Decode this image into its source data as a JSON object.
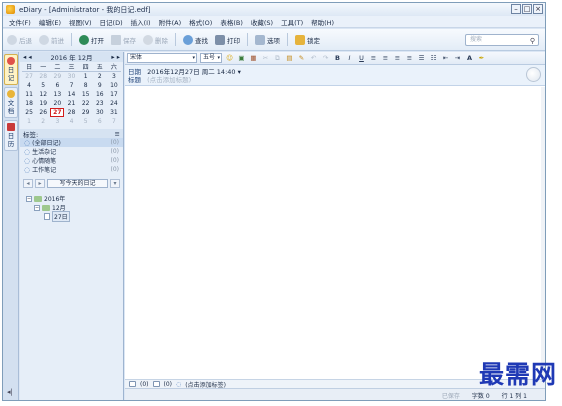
{
  "window": {
    "title": "eDiary - [Administrator - 我的日记.edf]",
    "controls": [
      "–",
      "□",
      "×"
    ]
  },
  "menu": [
    "文件(F)",
    "编辑(E)",
    "视图(V)",
    "日记(D)",
    "插入(I)",
    "附件(A)",
    "格式(O)",
    "表格(B)",
    "收藏(S)",
    "工具(T)",
    "帮助(H)"
  ],
  "toolbar": {
    "back": "后退",
    "forward": "前进",
    "open": "打开",
    "save": "保存",
    "delete": "删除",
    "find": "查找",
    "print": "打印",
    "options": "选项",
    "lock": "锁定",
    "search_placeholder": "搜索"
  },
  "leftstrip": {
    "tab_diary": "日记",
    "tab_docs": "文档",
    "tab_calendar": "日历"
  },
  "calendar": {
    "prev": "◂ ◂",
    "title": "2016 年 12月",
    "next": "▸ ▸",
    "weekdays": [
      "日",
      "一",
      "二",
      "三",
      "四",
      "五",
      "六"
    ],
    "weeks": [
      [
        "27",
        "28",
        "29",
        "30",
        "1",
        "2",
        "3"
      ],
      [
        "4",
        "5",
        "6",
        "7",
        "8",
        "9",
        "10"
      ],
      [
        "11",
        "12",
        "13",
        "14",
        "15",
        "16",
        "17"
      ],
      [
        "18",
        "19",
        "20",
        "21",
        "22",
        "23",
        "24"
      ],
      [
        "25",
        "26",
        "27",
        "28",
        "29",
        "30",
        "31"
      ],
      [
        "1",
        "2",
        "3",
        "4",
        "5",
        "6",
        "7"
      ]
    ],
    "today": "27"
  },
  "tags": {
    "header": "标签:",
    "items": [
      {
        "label": "(全部日记)",
        "count": "(0)"
      },
      {
        "label": "生活杂记",
        "count": "(0)"
      },
      {
        "label": "心情随笔",
        "count": "(0)"
      },
      {
        "label": "工作笔记",
        "count": "(0)"
      }
    ]
  },
  "write_today": "写今天的日记",
  "tree": {
    "year": "2016年",
    "month": "12月",
    "day": "27日"
  },
  "format": {
    "font": "宋体",
    "size": "五号",
    "bold": "B",
    "italic": "I",
    "underline": "U",
    "color": "A"
  },
  "entry": {
    "date_label": "日期",
    "date_value": "2016年12月27日  周二  14:40",
    "title_label": "标题",
    "title_placeholder": "(点击添加标题)"
  },
  "attach": {
    "count1": "(0)",
    "count2": "(0)",
    "add_tag": "(点击添加标签)"
  },
  "status": {
    "saved": "已保存",
    "chars": "字数  0",
    "rowcol": "行  1  列  1"
  },
  "watermark": "最需网"
}
